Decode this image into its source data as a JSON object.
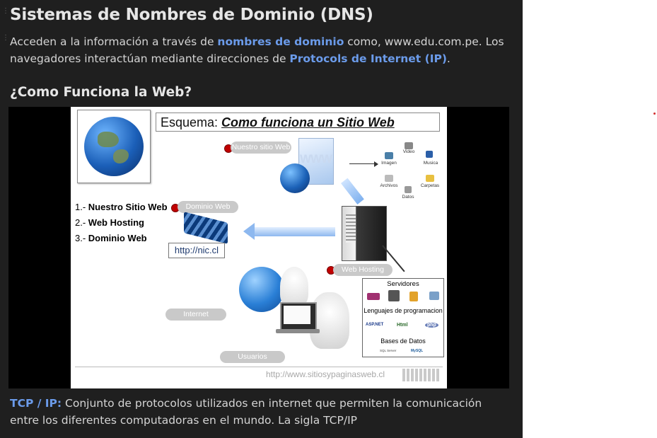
{
  "page": {
    "title": "Sistemas de Nombres de Dominio (DNS)",
    "intro": {
      "t1": "Acceden a la información a través de ",
      "link1": "nombres de dominio",
      "t2": " como, www.edu.com.pe. Los navegadores interactúan mediante direcciones de ",
      "link2": "Protocols de Internet (IP)",
      "t3": "."
    },
    "subtitle": "¿Como Funciona la Web?",
    "footer": {
      "term": "TCP / IP:",
      "text": " Conjunto de protocolos utilizados en internet que permiten la comunicación entre los diferentes computadoras en el mundo. La sigla TCP/IP"
    }
  },
  "slide": {
    "heading_prefix": "Esquema: ",
    "heading_emph": "Como funciona un Sitio Web",
    "list": [
      {
        "num": "1.- ",
        "label": "Nuestro Sitio Web"
      },
      {
        "num": "2.- ",
        "label": "Web Hosting"
      },
      {
        "num": "3.- ",
        "label": "Dominio Web"
      }
    ],
    "labels": {
      "nuestro_sitio": "Nuestro sitio Web",
      "dominio": "Dominio Web",
      "hosting": "Web Hosting",
      "internet": "Internet",
      "usuarios": "Usuarios",
      "www": "WWW",
      "nic": "http://nic.cl",
      "footer_url": "http://www.sitiosypaginasweb.cl"
    },
    "content_icons": [
      "Video",
      "Imagen",
      "Musica",
      "Archivos",
      "Carpetas",
      "Datos"
    ],
    "server_box": {
      "title": "Servidores",
      "lang_title": "Lenguajes de programacion",
      "lang": [
        "ASP.NET",
        "Html",
        "php"
      ],
      "db_title": "Bases de Datos",
      "db": [
        "SQL Server",
        "MySQL"
      ]
    }
  },
  "colors": {
    "panel_bg": "#1f1f1f",
    "link": "#6b9bea",
    "pill": "#c9c9c9",
    "marker_red": "#c00000"
  }
}
